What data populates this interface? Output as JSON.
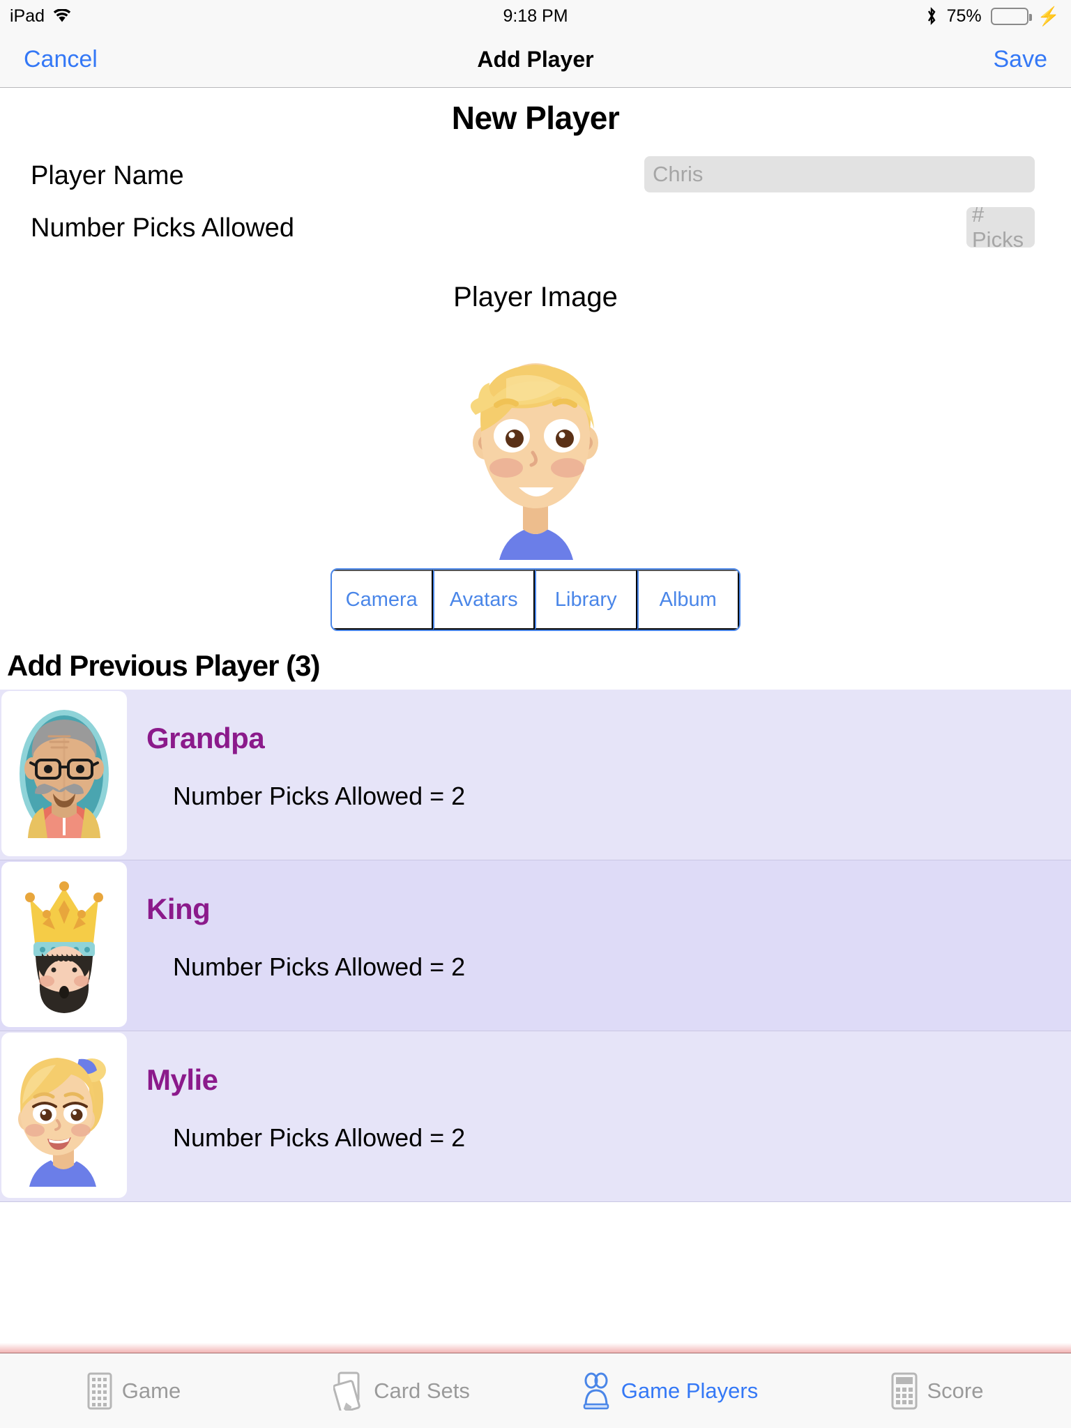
{
  "status_bar": {
    "device_label": "iPad",
    "wifi_icon": "wifi-icon",
    "time": "9:18 PM",
    "bluetooth_icon": "bluetooth-icon",
    "battery_percent": "75%",
    "battery_level": 75,
    "battery_color": "#4cd964",
    "charging_icon": "lightning-bolt-icon"
  },
  "nav_bar": {
    "cancel_label": "Cancel",
    "title": "Add Player",
    "save_label": "Save",
    "tint_color": "#3478f6"
  },
  "form": {
    "page_title": "New Player",
    "name_label": "Player Name",
    "name_value": "",
    "name_placeholder": "Chris",
    "picks_label": "Number Picks Allowed",
    "picks_value": "",
    "picks_placeholder": "# Picks",
    "image_section_title": "Player Image",
    "avatar_name": "blonde-boy-avatar"
  },
  "image_source_options": [
    {
      "label": "Camera",
      "name": "camera"
    },
    {
      "label": "Avatars",
      "name": "avatars"
    },
    {
      "label": "Library",
      "name": "library"
    },
    {
      "label": "Album",
      "name": "album"
    }
  ],
  "previous_players": {
    "header": "Add Previous Player (3)",
    "count": 3,
    "name_color": "#8b1a8b",
    "row_background": "#e6e4f8",
    "row_background_selected": "#dedbf7",
    "items": [
      {
        "name": "Grandpa",
        "detail": "Number Picks Allowed = 2",
        "picks": 2,
        "avatar": "grandpa-avatar",
        "selected": false
      },
      {
        "name": "King",
        "detail": "Number Picks Allowed = 2",
        "picks": 2,
        "avatar": "king-avatar",
        "selected": true
      },
      {
        "name": "Mylie",
        "detail": "Number Picks Allowed = 2",
        "picks": 2,
        "avatar": "girl-avatar",
        "selected": false
      }
    ]
  },
  "tab_bar": {
    "active_color": "#3478f6",
    "inactive_color": "#9a9a9a",
    "tabs": [
      {
        "label": "Game",
        "icon": "grid-icon",
        "active": false
      },
      {
        "label": "Card Sets",
        "icon": "playing-cards-icon",
        "active": false
      },
      {
        "label": "Game Players",
        "icon": "people-icon",
        "active": true
      },
      {
        "label": "Score",
        "icon": "calculator-icon",
        "active": false
      }
    ]
  }
}
